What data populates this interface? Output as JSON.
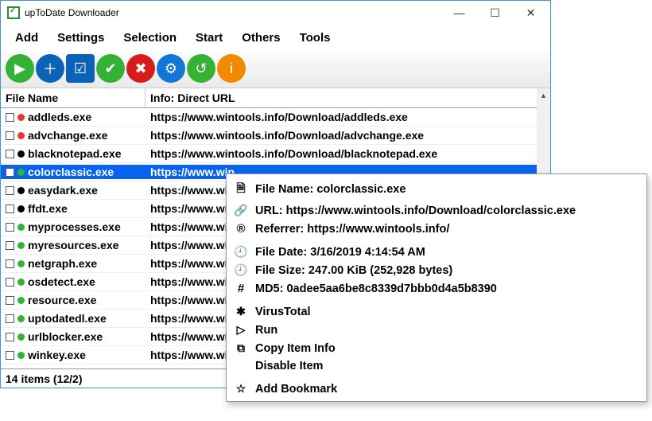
{
  "title": "upToDate Downloader",
  "menubar": [
    "Add",
    "Settings",
    "Selection",
    "Start",
    "Others",
    "Tools"
  ],
  "toolbar": [
    {
      "name": "play-button",
      "cls": "tb-play",
      "glyph": "▶"
    },
    {
      "name": "add-button",
      "cls": "tb-plus",
      "glyph": "＋"
    },
    {
      "name": "checkbox-button",
      "cls": "tb-check",
      "glyph": "☑"
    },
    {
      "name": "ok-button",
      "cls": "tb-ok",
      "glyph": "✔"
    },
    {
      "name": "delete-button",
      "cls": "tb-del",
      "glyph": "✖"
    },
    {
      "name": "settings-button",
      "cls": "tb-gear",
      "glyph": "⚙"
    },
    {
      "name": "refresh-button",
      "cls": "tb-reload",
      "glyph": "↺"
    },
    {
      "name": "info-button",
      "cls": "tb-info",
      "glyph": "i"
    }
  ],
  "columns": {
    "file": "File Name",
    "info": "Info: Direct URL"
  },
  "files": [
    {
      "dot": "red",
      "name": "addleds.exe",
      "url": "https://www.wintools.info/Download/addleds.exe"
    },
    {
      "dot": "red",
      "name": "advchange.exe",
      "url": "https://www.wintools.info/Download/advchange.exe"
    },
    {
      "dot": "blk",
      "name": "blacknotepad.exe",
      "url": "https://www.wintools.info/Download/blacknotepad.exe"
    },
    {
      "dot": "grn",
      "name": "colorclassic.exe",
      "url": "https://www.win",
      "selected": true
    },
    {
      "dot": "blk",
      "name": "easydark.exe",
      "url": "https://www.win"
    },
    {
      "dot": "blk",
      "name": "ffdt.exe",
      "url": "https://www.win"
    },
    {
      "dot": "grn",
      "name": "myprocesses.exe",
      "url": "https://www.win"
    },
    {
      "dot": "grn",
      "name": "myresources.exe",
      "url": "https://www.win"
    },
    {
      "dot": "grn",
      "name": "netgraph.exe",
      "url": "https://www.win"
    },
    {
      "dot": "grn",
      "name": "osdetect.exe",
      "url": "https://www.win"
    },
    {
      "dot": "grn",
      "name": "resource.exe",
      "url": "https://www.win"
    },
    {
      "dot": "grn",
      "name": "uptodatedl.exe",
      "url": "https://www.win"
    },
    {
      "dot": "grn",
      "name": "urlblocker.exe",
      "url": "https://www.win"
    },
    {
      "dot": "grn",
      "name": "winkey.exe",
      "url": "https://www.win"
    }
  ],
  "status": "14 items (12/2)",
  "context": {
    "filename_label": "File Name: colorclassic.exe",
    "url_label": "URL: https://www.wintools.info/Download/colorclassic.exe",
    "referrer_label": "Referrer: https://www.wintools.info/",
    "date_label": "File Date: 3/16/2019 4:14:54 AM",
    "size_label": "File Size: 247.00 KiB (252,928 bytes)",
    "md5_label": "MD5: 0adee5aa6be8c8339d7bbb0d4a5b8390",
    "virustotal": "VirusTotal",
    "run": "Run",
    "copy": "Copy Item Info",
    "disable": "Disable Item",
    "bookmark": "Add Bookmark"
  }
}
